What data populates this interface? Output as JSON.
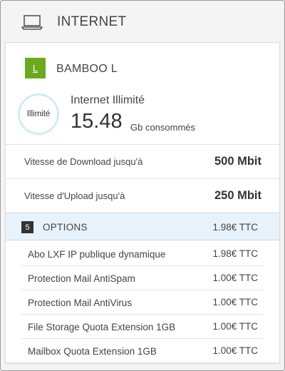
{
  "header": {
    "title": "INTERNET",
    "icon": "laptop-icon"
  },
  "plan": {
    "badge_letter": "L",
    "badge_color": "#6aaa1f",
    "name": "BAMBOO L"
  },
  "usage": {
    "ring_label": "Illimité",
    "title": "Internet Illimité",
    "value": "15.48",
    "unit": "Gb consommés"
  },
  "speeds": [
    {
      "label": "Vitesse de Download jusqu'à",
      "value": "500 Mbit"
    },
    {
      "label": "Vitesse d'Upload jusqu'à",
      "value": "250 Mbit"
    }
  ],
  "options": {
    "count": "5",
    "label": "OPTIONS",
    "total": "1.98€ TTC",
    "items": [
      {
        "name": "Abo LXF IP publique dynamique",
        "price": "1.98€ TTC"
      },
      {
        "name": "Protection Mail AntiSpam",
        "price": "1.00€ TTC"
      },
      {
        "name": "Protection Mail AntiVirus",
        "price": "1.00€ TTC"
      },
      {
        "name": "File Storage Quota Extension 1GB",
        "price": "1.00€ TTC"
      },
      {
        "name": "Mailbox Quota Extension 1GB",
        "price": "1.00€ TTC"
      }
    ]
  }
}
